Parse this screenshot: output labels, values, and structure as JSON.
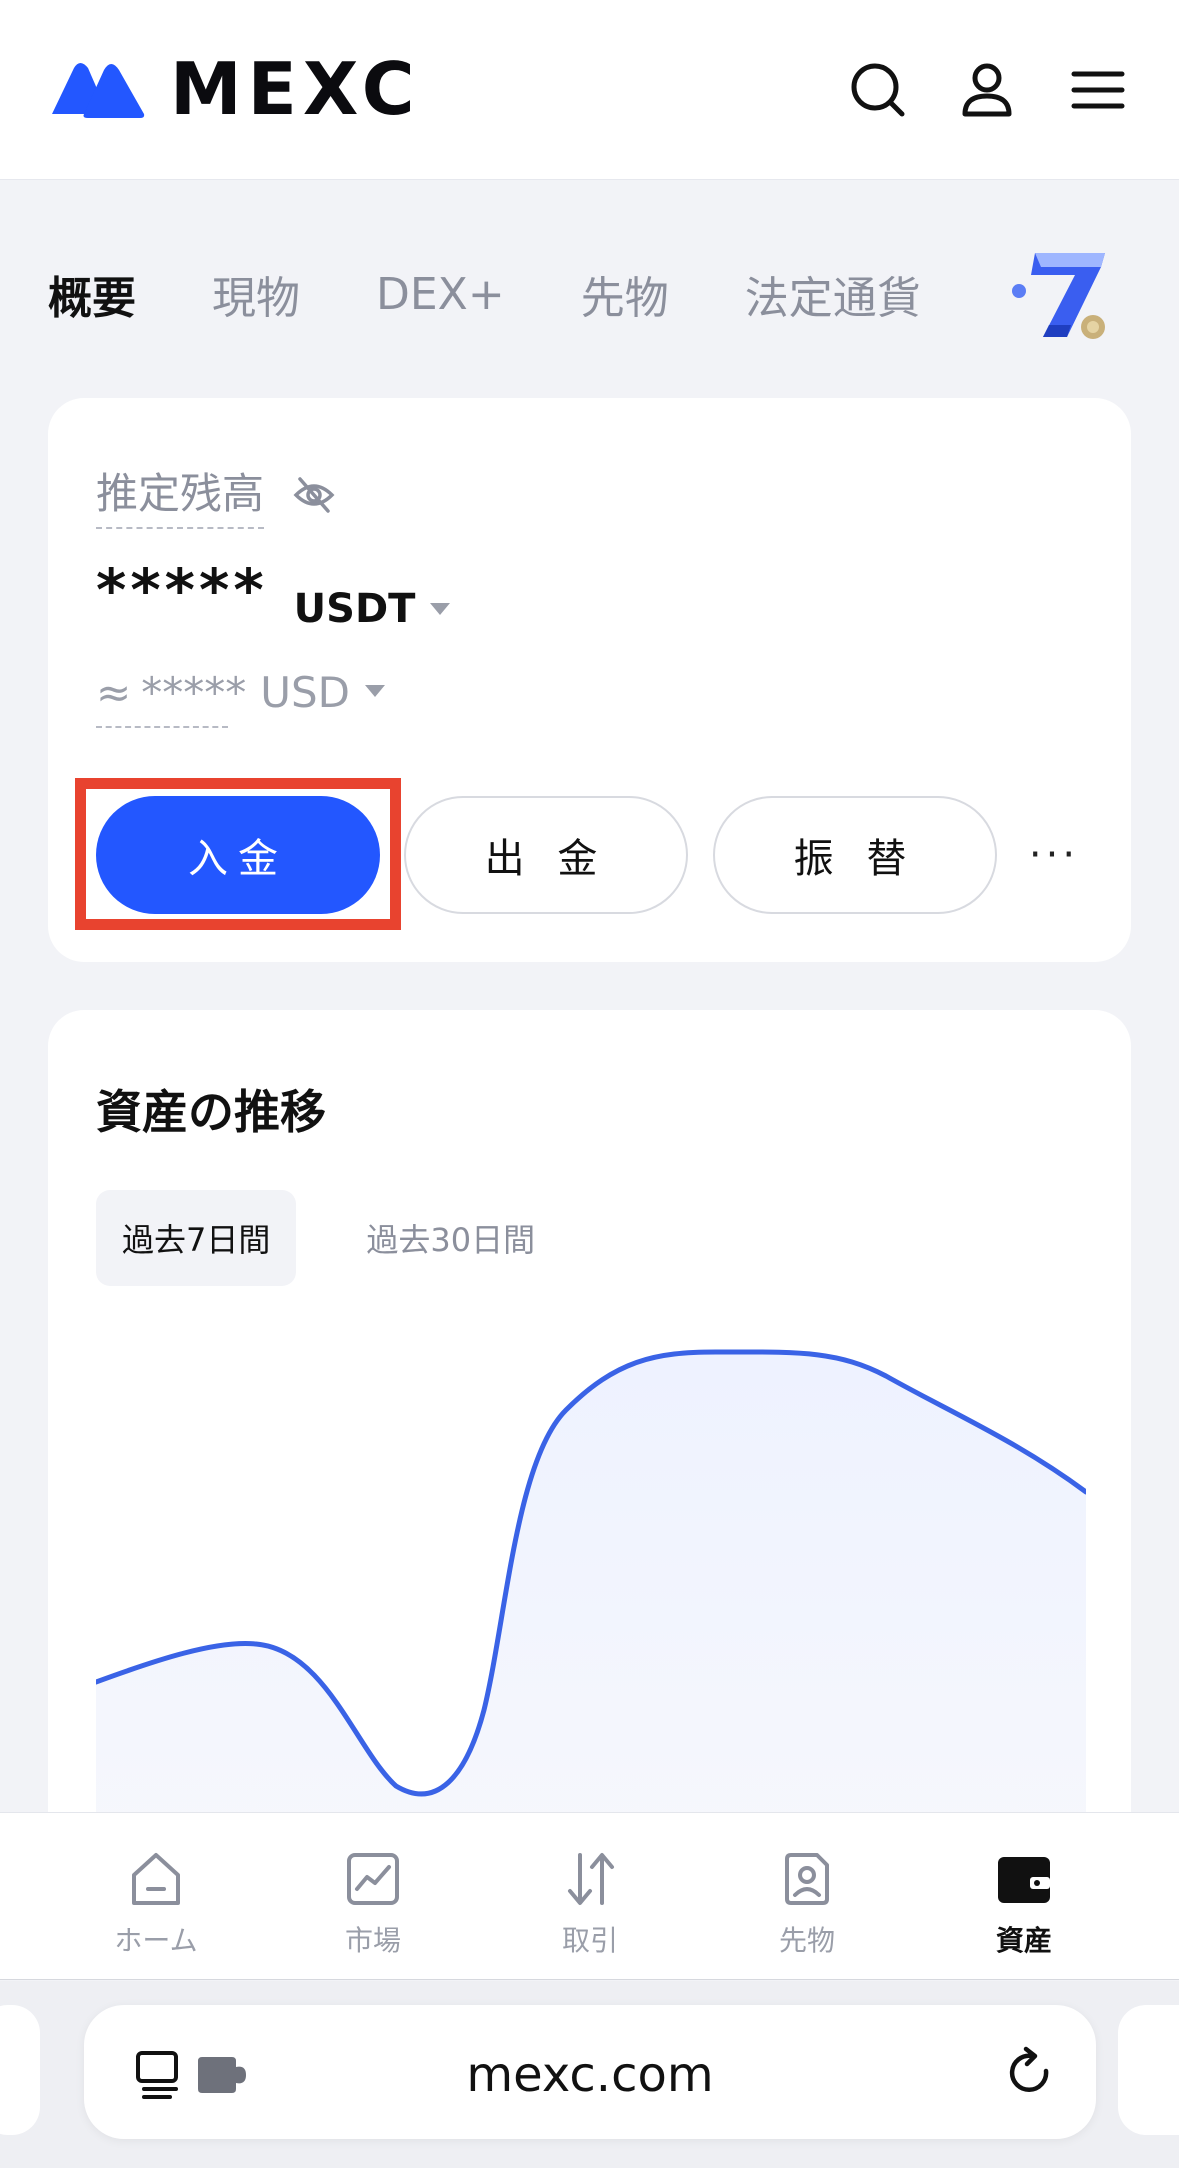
{
  "header": {
    "brand": "MEXC",
    "brand_color": "#2357ff",
    "icons": [
      "search-icon",
      "user-icon",
      "menu-icon"
    ]
  },
  "tabs": [
    {
      "label": "概要",
      "active": true
    },
    {
      "label": "現物",
      "active": false
    },
    {
      "label": "DEX+",
      "active": false
    },
    {
      "label": "先物",
      "active": false
    },
    {
      "label": "法定通貨",
      "active": false
    }
  ],
  "balance": {
    "label": "推定残高",
    "masked_value": "*****",
    "currency": "USDT",
    "approx_prefix": "≈",
    "approx_masked": "*****",
    "approx_currency": "USD"
  },
  "actions": {
    "deposit": "入金",
    "withdraw": "出 金",
    "transfer": "振 替",
    "more": "···"
  },
  "highlight_color": "#e8432f",
  "trend": {
    "title": "資産の推移",
    "ranges": [
      {
        "label": "過去7日間",
        "active": true
      },
      {
        "label": "過去30日間",
        "active": false
      }
    ],
    "line_color": "#3a63e6"
  },
  "bottom_nav": [
    {
      "label": "ホーム",
      "icon": "home-icon",
      "active": false
    },
    {
      "label": "市場",
      "icon": "market-chart-icon",
      "active": false
    },
    {
      "label": "取引",
      "icon": "trade-arrows-icon",
      "active": false
    },
    {
      "label": "先物",
      "icon": "futures-doc-icon",
      "active": false
    },
    {
      "label": "資産",
      "icon": "wallet-icon",
      "active": true
    }
  ],
  "browser": {
    "url": "mexc.com"
  }
}
